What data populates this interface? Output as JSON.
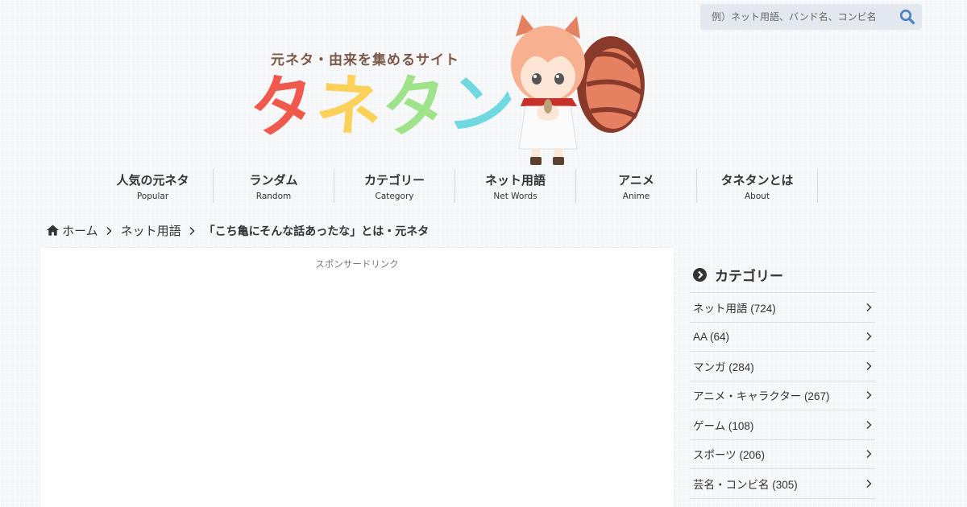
{
  "search": {
    "placeholder": "例）ネット用語、バンド名、コンビ名"
  },
  "header": {
    "tagline": "元ネタ・由来を集めるサイト",
    "logo_chars": [
      "タ",
      "ネ",
      "タ",
      "ン"
    ],
    "logo_colors": [
      "#ef5a4c",
      "#fdd05a",
      "#9ee38a",
      "#6fd8e0"
    ]
  },
  "nav": [
    {
      "label": "人気の元ネタ",
      "sub": "Popular"
    },
    {
      "label": "ランダム",
      "sub": "Random"
    },
    {
      "label": "カテゴリー",
      "sub": "Category"
    },
    {
      "label": "ネット用語",
      "sub": "Net Words"
    },
    {
      "label": "アニメ",
      "sub": "Anime"
    },
    {
      "label": "タネタンとは",
      "sub": "About"
    }
  ],
  "breadcrumb": {
    "home": "ホーム",
    "category": "ネット用語",
    "current": "「こち亀にそんな話あったな」とは・元ネタ"
  },
  "main": {
    "sponsor_label": "スポンサードリンク"
  },
  "sidebar": {
    "title": "カテゴリー",
    "categories": [
      "ネット用語 (724)",
      "AA (64)",
      "マンガ (284)",
      "アニメ・キャラクター (267)",
      "ゲーム (108)",
      "スポーツ (206)",
      "芸名・コンビ名 (305)"
    ]
  }
}
